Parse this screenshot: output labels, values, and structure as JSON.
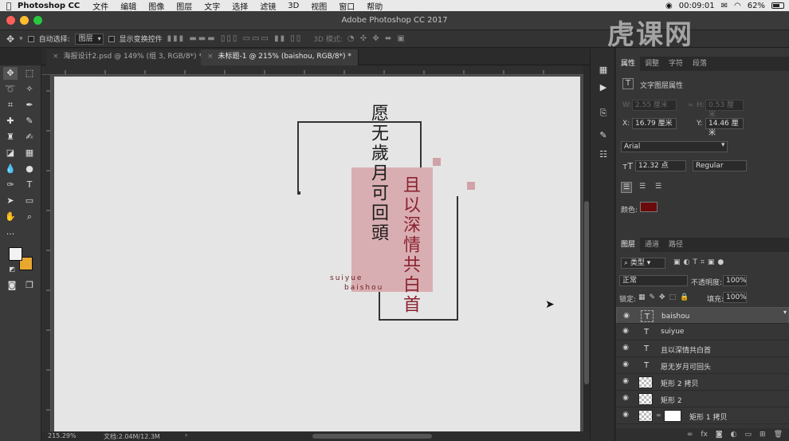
{
  "menubar": {
    "app_name": "Photoshop CC",
    "items": [
      "文件",
      "编辑",
      "图像",
      "图层",
      "文字",
      "选择",
      "滤镜",
      "3D",
      "视图",
      "窗口",
      "帮助"
    ],
    "clock": "00:09:01",
    "battery": "62%"
  },
  "window": {
    "title": "Adobe Photoshop CC 2017"
  },
  "options": {
    "auto_select_label": "自动选择:",
    "auto_select_value": "图层",
    "show_transform_label": "显示变换控件",
    "mode_3d_label": "3D 模式:"
  },
  "tabs": [
    {
      "label": "海报设计2.psd @ 149% (组 3, RGB/8*) *",
      "active": false
    },
    {
      "label": "未标题-1 @ 215% (baishou, RGB/8*) *",
      "active": true
    }
  ],
  "artwork": {
    "text_a": "愿无歲月可回頭",
    "text_b": "且以深情共白首",
    "latin_1": "suiyue",
    "latin_2": "baishou"
  },
  "status": {
    "zoom": "215.29%",
    "doc": "文档:2.04M/12.3M"
  },
  "properties": {
    "tabs": [
      "属性",
      "调整",
      "字符",
      "段落"
    ],
    "header": "文字图层属性",
    "w_label": "W:",
    "w_value": "2.55 厘米",
    "h_label": "H:",
    "h_value": "0.53 厘米",
    "x_label": "X:",
    "x_value": "16.79 厘米",
    "y_label": "Y:",
    "y_value": "14.46 厘米",
    "font": "Arial",
    "size": "12.32 点",
    "style": "Regular",
    "color_label": "颜色:",
    "color_value": "#6b0a0a"
  },
  "layers": {
    "tabs": [
      "图层",
      "通道",
      "路径"
    ],
    "filter_label": "类型",
    "blend_mode": "正常",
    "opacity_label": "不透明度:",
    "opacity_value": "100%",
    "lock_label": "锁定:",
    "fill_label": "填充:",
    "fill_value": "100%",
    "items": [
      {
        "name": "baishou",
        "kind": "text",
        "selected": true
      },
      {
        "name": "suiyue",
        "kind": "text",
        "selected": false
      },
      {
        "name": "且以深情共白首",
        "kind": "text",
        "selected": false
      },
      {
        "name": "愿无岁月可回头",
        "kind": "text",
        "selected": false
      },
      {
        "name": "矩形 2 拷贝",
        "kind": "shape",
        "selected": false
      },
      {
        "name": "矩形 2",
        "kind": "shape",
        "selected": false
      },
      {
        "name": "矩形 1 拷贝",
        "kind": "shape",
        "selected": false
      }
    ]
  },
  "watermark": "虎课网",
  "colors": {
    "pink_block": "#d9aeb2",
    "accent_square": "#d0a3a8",
    "dark_red_text": "#8a2230",
    "canvas": "#e6e5e5"
  }
}
